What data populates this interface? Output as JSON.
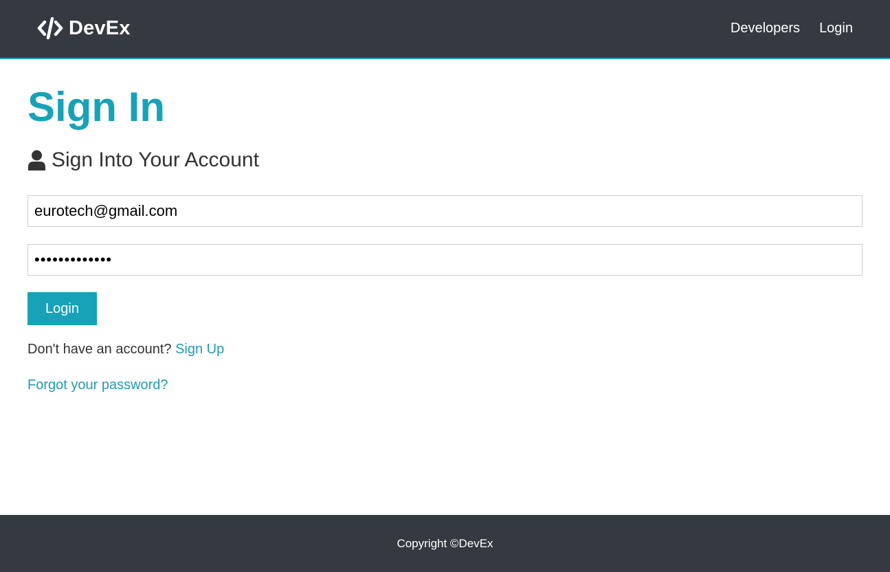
{
  "navbar": {
    "brand": "DevEx",
    "brand_icon": "code-icon",
    "links": [
      "Developers",
      "Login"
    ]
  },
  "main": {
    "title": "Sign In",
    "lead_icon": "user-icon",
    "lead": "Sign Into Your Account",
    "email_value": "eurotech@gmail.com",
    "password_value": "eurotech12345",
    "login_button": "Login",
    "signup_prompt": "Don't have an account?",
    "signup_link": "Sign Up",
    "forgot_link": "Forgot your password?"
  },
  "footer": {
    "text": "Copyright ©DevEx"
  },
  "colors": {
    "navbar_bg": "#343a40",
    "accent": "#17a2b8",
    "link": "#1f9bb0"
  }
}
